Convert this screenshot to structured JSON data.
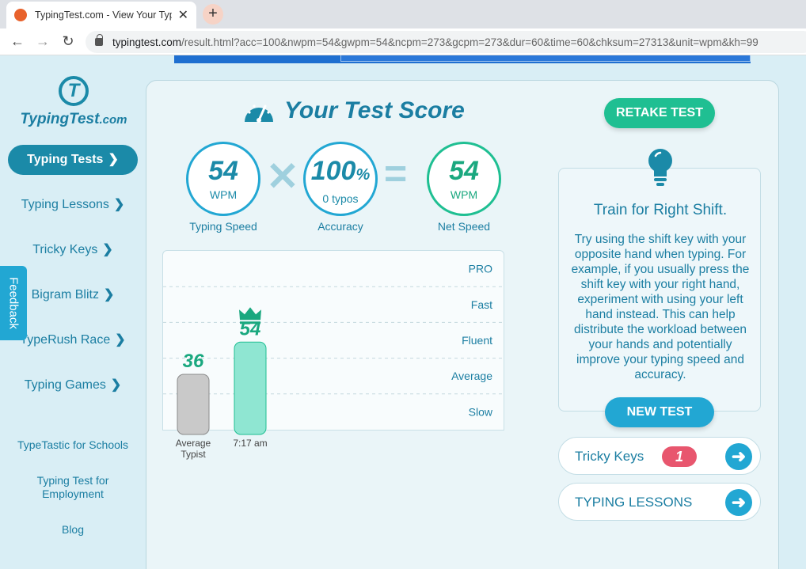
{
  "browser": {
    "tab_title": "TypingTest.com - View Your Typin",
    "tab_close": "✕",
    "new_tab": "+",
    "url_host": "typingtest.com",
    "url_path": "/result.html?acc=100&nwpm=54&gwpm=54&ncpm=273&gcpm=273&dur=60&time=60&chksum=27313&unit=wpm&kh=99",
    "back": "←",
    "forward": "→",
    "reload": "↻"
  },
  "sidebar": {
    "logo_text": "TypingTest",
    "logo_suffix": ".com",
    "logo_mark": "T",
    "nav": [
      {
        "label": "Typing Tests",
        "active": true
      },
      {
        "label": "Typing Lessons"
      },
      {
        "label": "Tricky Keys"
      },
      {
        "label": "Bigram Blitz"
      },
      {
        "label": "TypeRush Race"
      },
      {
        "label": "Typing Games"
      }
    ],
    "chevron": "❯",
    "links": [
      "TypeTastic for Schools",
      "Typing Test for Employment",
      "Blog"
    ],
    "feedback": "Feedback"
  },
  "result": {
    "heading": "Your Test Score",
    "typing_speed": {
      "value": "54",
      "unit": "WPM",
      "label": "Typing Speed"
    },
    "accuracy": {
      "value": "100",
      "pct": "%",
      "unit": "0 typos",
      "label": "Accuracy"
    },
    "net_speed": {
      "value": "54",
      "unit": "WPM",
      "label": "Net Speed"
    },
    "times_sign": "✕",
    "equals_sign": "="
  },
  "chart_data": {
    "type": "bar",
    "categories": [
      "Average Typist",
      "7:17 am"
    ],
    "values": [
      36,
      54
    ],
    "data_labels": [
      "36",
      "54"
    ],
    "ylim": [
      5,
      105
    ],
    "y_ticks": [
      25,
      45,
      65,
      85
    ],
    "bands": [
      "Slow",
      "Average",
      "Fluent",
      "Fast",
      "PRO"
    ],
    "colors": {
      "average": "#c9c9c9",
      "you": "#8fe6d2",
      "label_green": "#1aa87f"
    }
  },
  "actions": {
    "retake": "RETAKE TEST",
    "new_test": "NEW TEST"
  },
  "tip": {
    "title": "Train for Right Shift.",
    "text": "Try using the shift key with your opposite hand when typing. For example, if you usually press the shift key with your right hand, experiment with using your left hand instead. This can help distribute the workload between your hands and potentially improve your typing speed and accuracy."
  },
  "links": {
    "tricky_keys": {
      "label": "Tricky Keys",
      "badge": "1"
    },
    "lessons": {
      "label": "TYPING LESSONS"
    },
    "arrow": "➜"
  },
  "colors": {
    "primary": "#1b8aa8",
    "green": "#1fbf92",
    "blue": "#22a7d3",
    "badge": "#e8566e"
  }
}
